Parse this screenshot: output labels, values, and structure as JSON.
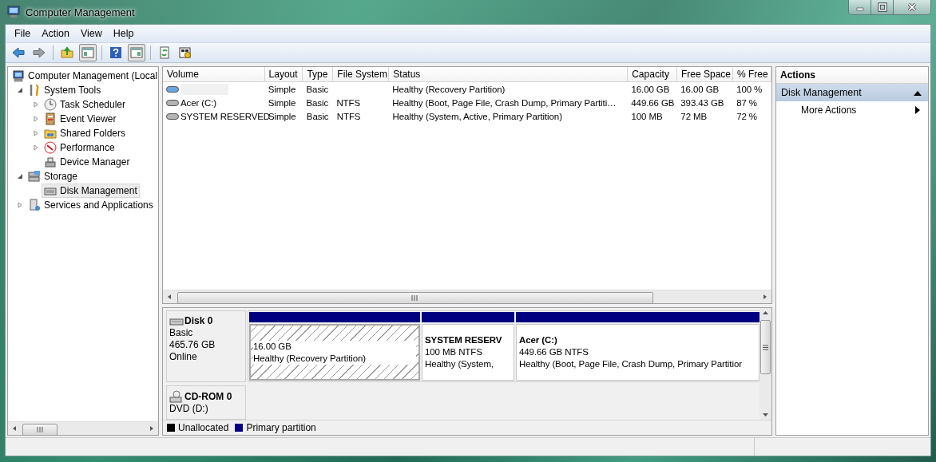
{
  "window": {
    "title": "Computer Management"
  },
  "menu": [
    "File",
    "Action",
    "View",
    "Help"
  ],
  "tree": [
    {
      "label": "Computer Management (Local",
      "selected": false,
      "children": [
        {
          "label": "System Tools",
          "expanded": true,
          "selected": false,
          "children": [
            {
              "label": "Task Scheduler",
              "expanded": false,
              "selected": false
            },
            {
              "label": "Event Viewer",
              "expanded": false,
              "selected": false
            },
            {
              "label": "Shared Folders",
              "expanded": false,
              "selected": false
            },
            {
              "label": "Performance",
              "expanded": false,
              "selected": false
            },
            {
              "label": "Device Manager",
              "selected": false
            }
          ]
        },
        {
          "label": "Storage",
          "expanded": true,
          "selected": false,
          "children": [
            {
              "label": "Disk Management",
              "selected": true
            }
          ]
        },
        {
          "label": "Services and Applications",
          "expanded": false,
          "selected": false
        }
      ]
    }
  ],
  "volumes": {
    "columns": [
      "Volume",
      "Layout",
      "Type",
      "File System",
      "Status",
      "Capacity",
      "Free Space",
      "% Free"
    ],
    "rows": [
      {
        "color": "#6aa6e0",
        "layout": "Simple",
        "type": "Basic",
        "status": "Healthy (Recovery Partition)",
        "capacity": "16.00 GB",
        "free_space": "16.00 GB",
        "percent_free": "100 %"
      },
      {
        "color": "#b4b4b4",
        "volume": "Acer (C:)",
        "layout": "Simple",
        "type": "Basic",
        "file_system": "NTFS",
        "status": "Healthy (Boot, Page File, Crash Dump, Primary Partiti…",
        "capacity": "449.66 GB",
        "free_space": "393.43 GB",
        "percent_free": "87 %"
      },
      {
        "color": "#b4b4b4",
        "volume": "SYSTEM RESERVED",
        "layout": "Simple",
        "type": "Basic",
        "file_system": "NTFS",
        "status": "Healthy (System, Active, Primary Partition)",
        "capacity": "100 MB",
        "free_space": "72 MB",
        "percent_free": "72 %"
      }
    ]
  },
  "disks": [
    {
      "kind": "disk",
      "name": "Disk 0",
      "type": "Basic",
      "size": "465.76 GB",
      "status": "Online",
      "partitions": [
        {
          "size": "16.00 GB",
          "status": "Healthy (Recovery Partition)",
          "selected": true
        },
        {
          "name": "SYSTEM RESERV",
          "size": "100 MB NTFS",
          "status": "Healthy (System,",
          "selected": false
        },
        {
          "name": "Acer  (C:)",
          "size": "449.66 GB NTFS",
          "status": "Healthy (Boot, Page File, Crash Dump, Primary Partitior",
          "selected": false
        }
      ]
    },
    {
      "kind": "cdrom",
      "name": "CD-ROM 0",
      "type": "DVD (D:)"
    }
  ],
  "legend": [
    {
      "label": "Unallocated",
      "color": "#000000"
    },
    {
      "label": "Primary partition",
      "color": "#000080"
    }
  ],
  "actions": {
    "title": "Actions",
    "section": {
      "label": "Disk Management",
      "expanded": true
    },
    "items": [
      "More Actions"
    ]
  }
}
